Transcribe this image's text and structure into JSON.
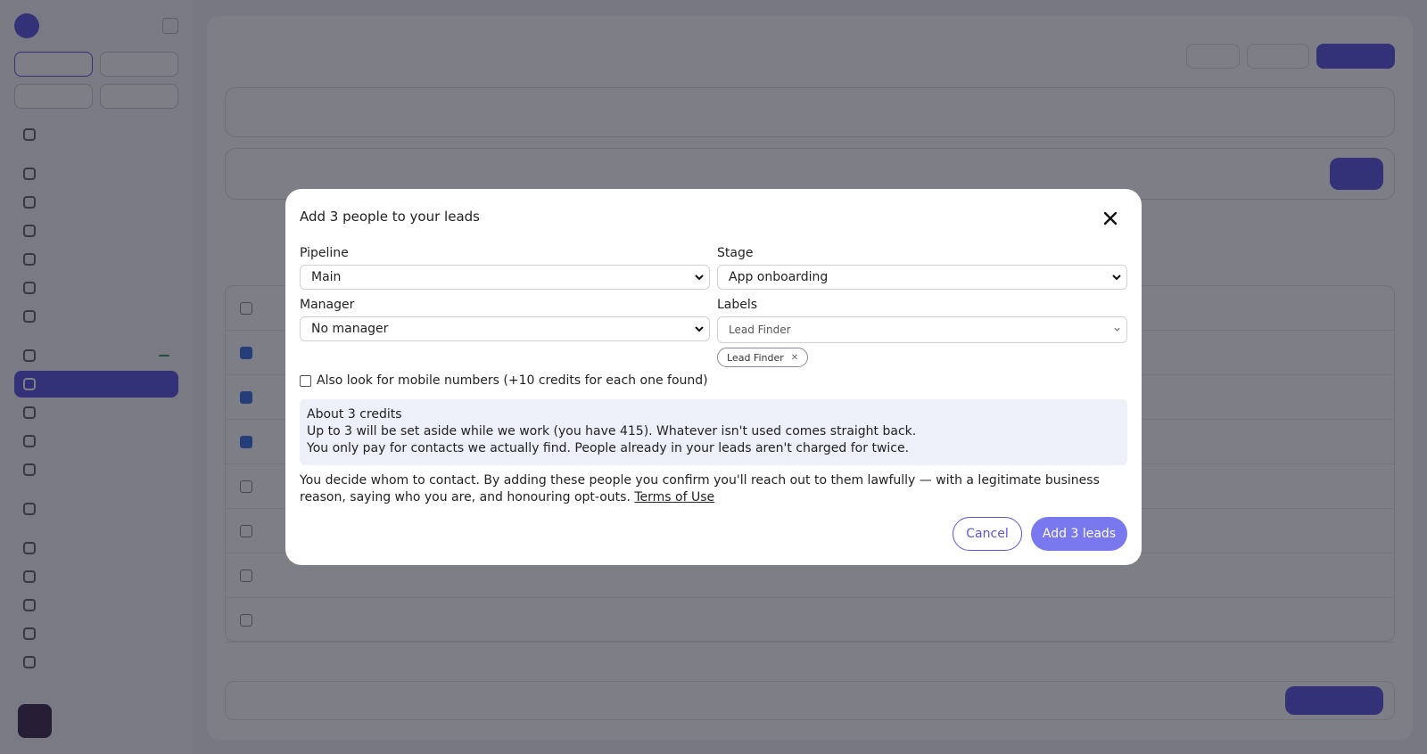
{
  "modal": {
    "title": "Add 3 people to your leads",
    "pipeline": {
      "label": "Pipeline",
      "value": "Main"
    },
    "stage": {
      "label": "Stage",
      "value": "App onboarding"
    },
    "manager": {
      "label": "Manager",
      "value": "No manager"
    },
    "labels": {
      "label": "Labels",
      "value": "Lead Finder",
      "chips": [
        "Lead Finder"
      ]
    },
    "mobile_option": {
      "label": "Also look for mobile numbers (+10 credits for each one found)",
      "checked": false
    },
    "credits": {
      "heading": "About 3 credits",
      "line1": "Up to 3 will be set aside while we work (you have 415). Whatever isn't used comes straight back.",
      "line2": "You only pay for contacts we actually find. People already in your leads aren't charged for twice."
    },
    "consent_text": "You decide whom to contact. By adding these people you confirm you'll reach out to them lawfully — with a legitimate business reason, saying who you are, and honouring opt-outs.",
    "terms_link": "Terms of Use",
    "cancel_label": "Cancel",
    "add_label": "Add 3 leads"
  },
  "colors": {
    "accent": "#5a55e0",
    "add_button": "#7a78ee",
    "credits_bg": "#eef0f9",
    "overlay": "rgba(20,20,35,0.55)"
  }
}
